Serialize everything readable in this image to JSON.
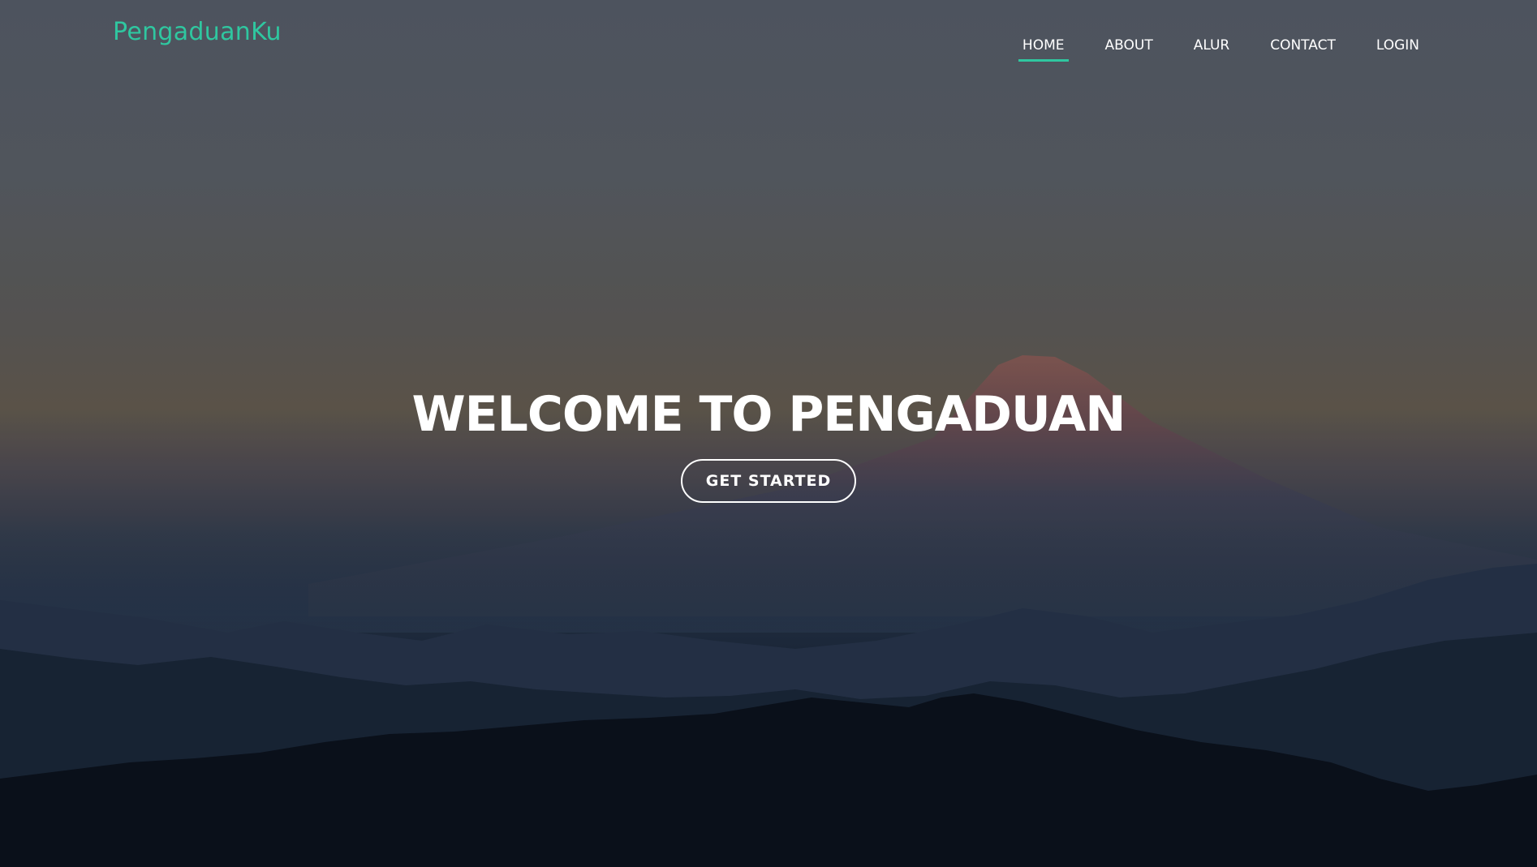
{
  "header": {
    "logo": "PengaduanKu",
    "nav": [
      {
        "label": "HOME",
        "active": true
      },
      {
        "label": "ABOUT",
        "active": false
      },
      {
        "label": "ALUR",
        "active": false
      },
      {
        "label": "CONTACT",
        "active": false
      },
      {
        "label": "LOGIN",
        "active": false
      }
    ]
  },
  "hero": {
    "title": "WELCOME TO PENGADUAN",
    "cta_label": "GET STARTED"
  },
  "colors": {
    "accent": "#2fc7a0",
    "text": "#ffffff"
  }
}
